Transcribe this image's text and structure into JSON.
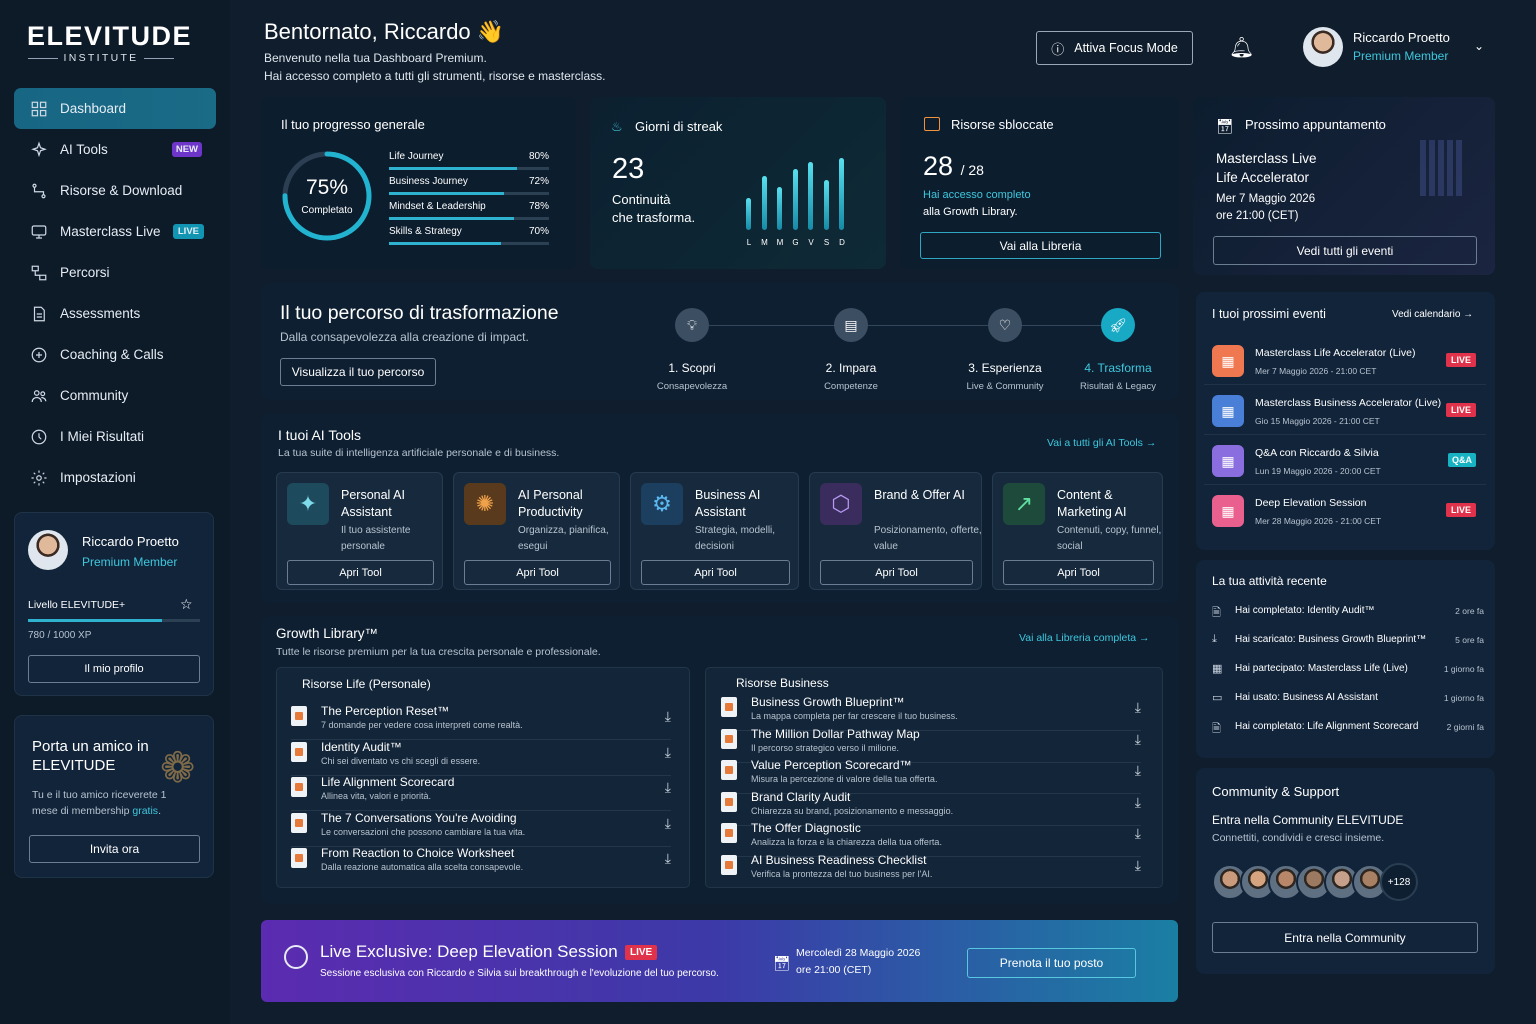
{
  "brand": {
    "name": "ELEVITUDE",
    "sub": "INSTITUTE"
  },
  "nav": [
    {
      "label": "Dashboard",
      "icon": "grid-icon",
      "active": true
    },
    {
      "label": "AI Tools",
      "icon": "sparkle-icon",
      "badge": "NEW"
    },
    {
      "label": "Risorse & Download",
      "icon": "path-icon"
    },
    {
      "label": "Masterclass Live",
      "icon": "monitor-icon",
      "badge": "LIVE"
    },
    {
      "label": "Percorsi",
      "icon": "route-icon"
    },
    {
      "label": "Assessments",
      "icon": "document-icon"
    },
    {
      "label": "Coaching & Calls",
      "icon": "coaching-icon"
    },
    {
      "label": "Community",
      "icon": "users-icon"
    },
    {
      "label": "I Miei Risultati",
      "icon": "target-icon"
    },
    {
      "label": "Impostazioni",
      "icon": "gear-icon"
    }
  ],
  "profile": {
    "name": "Riccardo Proetto",
    "role": "Premium Member",
    "level": "Livello ELEVITUDE+",
    "xp": "780 / 1000 XP",
    "xp_fraction": 0.78,
    "button": "Il mio profilo"
  },
  "referral": {
    "title": "Porta un amico in ELEVITUDE",
    "text": "Tu e il tuo amico riceverete 1 mese di membership",
    "highlight": "gratis",
    "button": "Invita ora"
  },
  "header": {
    "greeting": "Bentornato, Riccardo 👋",
    "sub1": "Benvenuto nella tua Dashboard Premium.",
    "sub2": "Hai accesso completo a tutti gli strumenti, risorse e masterclass.",
    "focus": "Attiva Focus Mode",
    "user": "Riccardo Proetto",
    "role": "Premium Member"
  },
  "progress": {
    "title": "Il tuo progresso generale",
    "value": "75%",
    "label": "Completato",
    "fraction": 0.75,
    "items": [
      {
        "label": "Life Journey",
        "pct": "80%",
        "v": 0.8
      },
      {
        "label": "Business Journey",
        "pct": "72%",
        "v": 0.72
      },
      {
        "label": "Mindset & Leadership",
        "pct": "78%",
        "v": 0.78
      },
      {
        "label": "Skills & Strategy",
        "pct": "70%",
        "v": 0.7
      }
    ]
  },
  "streak": {
    "title": "Giorni di streak",
    "value": "23",
    "l1": "Continuità",
    "l2": "che trasforma.",
    "days": [
      "L",
      "M",
      "M",
      "G",
      "V",
      "S",
      "D"
    ],
    "bars": [
      0.45,
      0.75,
      0.6,
      0.85,
      0.95,
      0.7,
      1.0
    ]
  },
  "resources": {
    "title": "Risorse sbloccate",
    "count": "28",
    "total": "/ 28",
    "l1": "Hai accesso completo",
    "l2": "alla Growth Library.",
    "button": "Vai alla Libreria"
  },
  "appointment": {
    "title": "Prossimo appuntamento",
    "l1": "Masterclass Live",
    "l2": "Life Accelerator",
    "date": "Mer 7 Maggio 2026",
    "time": "ore 21:00 (CET)",
    "button": "Vedi tutti gli eventi"
  },
  "journey": {
    "title": "Il tuo percorso di trasformazione",
    "sub": "Dalla consapevolezza alla creazione di impact.",
    "button": "Visualizza il tuo percorso",
    "steps": [
      {
        "n": "1. Scopri",
        "s": "Consapevolezza",
        "icon": "bulb-icon"
      },
      {
        "n": "2. Impara",
        "s": "Competenze",
        "icon": "book-icon"
      },
      {
        "n": "3. Esperienza",
        "s": "Live & Community",
        "icon": "chat-icon"
      },
      {
        "n": "4. Trasforma",
        "s": "Risultati & Legacy",
        "icon": "rocket-icon"
      }
    ]
  },
  "tools": {
    "title": "I tuoi AI Tools",
    "sub": "La tua suite di intelligenza artificiale personale e di business.",
    "link": "Vai a tutti gli AI Tools →",
    "items": [
      {
        "title": "Personal AI Assistant",
        "desc": "Il tuo assistente personale",
        "btn": "Apri Tool",
        "icon": "✦",
        "bg": "#1d4a5c",
        "fg": "#7fdcea"
      },
      {
        "title": "AI Personal Productivity",
        "desc": "Organizza, pianifica, esegui",
        "btn": "Apri Tool",
        "icon": "✺",
        "bg": "#5a3a1c",
        "fg": "#f0a24a"
      },
      {
        "title": "Business AI Assistant",
        "desc": "Strategia, modelli, decisioni",
        "btn": "Apri Tool",
        "icon": "⚙",
        "bg": "#1c3f5f",
        "fg": "#5bb8f0"
      },
      {
        "title": "Brand & Offer AI",
        "desc": "Posizionamento, offerte, value",
        "btn": "Apri Tool",
        "icon": "⬡",
        "bg": "#3a2c5c",
        "fg": "#b79af2"
      },
      {
        "title": "Content & Marketing AI",
        "desc": "Contenuti, copy, funnel, social",
        "btn": "Apri Tool",
        "icon": "↗",
        "bg": "#1d4a3a",
        "fg": "#5fe0a0"
      }
    ]
  },
  "library": {
    "title": "Growth Library™",
    "sub": "Tutte le risorse premium per la tua crescita personale e professionale.",
    "link": "Vai alla Libreria completa →",
    "life_title": "Risorse Life (Personale)",
    "life": [
      {
        "t": "The Perception Reset™",
        "s": "7 domande per vedere cosa interpreti come realtà."
      },
      {
        "t": "Identity Audit™",
        "s": "Chi sei diventato vs chi scegli di essere."
      },
      {
        "t": "Life Alignment Scorecard",
        "s": "Allinea vita, valori e priorità."
      },
      {
        "t": "The 7 Conversations You're Avoiding",
        "s": "Le conversazioni che possono cambiare la tua vita."
      },
      {
        "t": "From Reaction to Choice Worksheet",
        "s": "Dalla reazione automatica alla scelta consapevole."
      }
    ],
    "biz_title": "Risorse Business",
    "biz": [
      {
        "t": "Business Growth Blueprint™",
        "s": "La mappa completa per far crescere il tuo business."
      },
      {
        "t": "The Million Dollar Pathway Map",
        "s": "Il percorso strategico verso il milione."
      },
      {
        "t": "Value Perception Scorecard™",
        "s": "Misura la percezione di valore della tua offerta."
      },
      {
        "t": "Brand Clarity Audit",
        "s": "Chiarezza su brand, posizionamento e messaggio."
      },
      {
        "t": "The Offer Diagnostic",
        "s": "Analizza la forza e la chiarezza della tua offerta."
      },
      {
        "t": "AI Business Readiness Checklist",
        "s": "Verifica la prontezza del tuo business per l'AI."
      }
    ]
  },
  "banner": {
    "title": "Live Exclusive: Deep Elevation Session",
    "tag": "LIVE",
    "sub": "Sessione esclusiva con Riccardo e Silvia sui breakthrough e l'evoluzione del tuo percorso.",
    "date": "Mercoledì 28 Maggio 2026",
    "time": "ore 21:00 (CET)",
    "button": "Prenota il tuo posto"
  },
  "events": {
    "title": "I tuoi prossimi eventi",
    "link": "Vedi calendario →",
    "items": [
      {
        "t": "Masterclass Life Accelerator (Live)",
        "s": "Mer 7 Maggio 2026 - 21:00 CET",
        "tag": "LIVE",
        "bg": "#f07850"
      },
      {
        "t": "Masterclass Business Accelerator (Live)",
        "s": "Gio 15 Maggio 2026 - 21:00 CET",
        "tag": "LIVE",
        "bg": "#4a7fd8"
      },
      {
        "t": "Q&A con Riccardo & Silvia",
        "s": "Lun 19 Maggio 2026 - 20:00 CET",
        "tag": "Q&A",
        "bg": "#8a6ee0"
      },
      {
        "t": "Deep Elevation Session",
        "s": "Mer 28 Maggio 2026 - 21:00 CET",
        "tag": "LIVE",
        "bg": "#e9608e"
      }
    ]
  },
  "activity": {
    "title": "La tua attività recente",
    "items": [
      {
        "t": "Hai completato: Identity Audit™",
        "w": "2 ore fa",
        "icon": "doc-icon"
      },
      {
        "t": "Hai scaricato: Business Growth Blueprint™",
        "w": "5 ore fa",
        "icon": "download-icon"
      },
      {
        "t": "Hai partecipato: Masterclass Life (Live)",
        "w": "1 giorno fa",
        "icon": "calendar-icon"
      },
      {
        "t": "Hai usato: Business AI Assistant",
        "w": "1 giorno fa",
        "icon": "chat-icon"
      },
      {
        "t": "Hai completato: Life Alignment Scorecard",
        "w": "2 giorni fa",
        "icon": "doc-icon"
      }
    ]
  },
  "community": {
    "title": "Community & Support",
    "l1": "Entra nella Community ELEVITUDE",
    "l2": "Connettiti, condividi e cresci insieme.",
    "more": "+128",
    "button": "Entra nella Community"
  }
}
